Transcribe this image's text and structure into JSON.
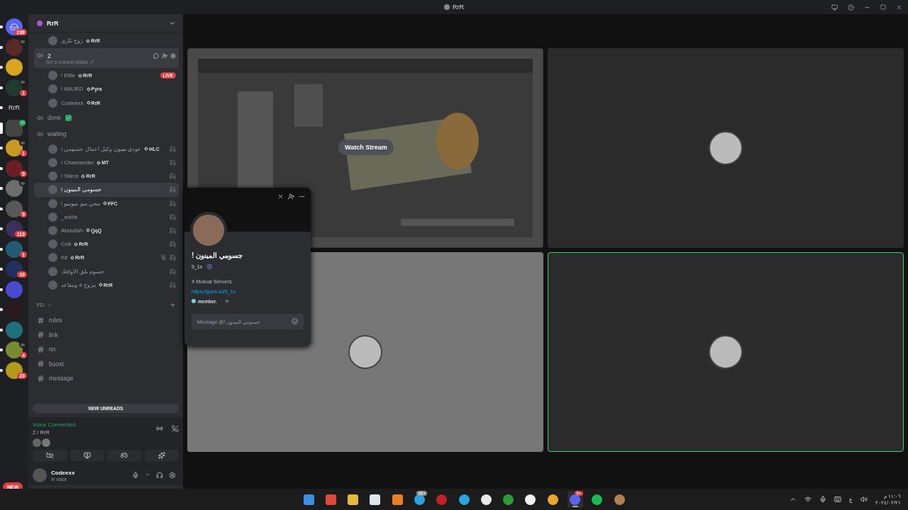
{
  "window": {
    "title": "RrR"
  },
  "servers": [
    {
      "kind": "home",
      "color": "#5865f2",
      "badge": "238",
      "voice": false,
      "selected": false
    },
    {
      "kind": "avatar",
      "color": "#5a2a2a",
      "voice": true,
      "selected": false
    },
    {
      "kind": "avatar",
      "color": "#d9a520",
      "voice": false,
      "selected": false
    },
    {
      "kind": "avatar",
      "color": "#1f3a30",
      "badge": "1",
      "voice": true,
      "selected": false
    },
    {
      "kind": "text",
      "label": "RrR",
      "voice": false,
      "selected": false
    },
    {
      "kind": "avatar",
      "color": "#444444",
      "voice": true,
      "selected": true
    },
    {
      "kind": "avatar",
      "color": "#c99a22",
      "badge": "1",
      "voice": true,
      "selected": false
    },
    {
      "kind": "avatar",
      "color": "#6b1f24",
      "badge": "5",
      "voice": false,
      "selected": false
    },
    {
      "kind": "avatar",
      "color": "#6e6e6e",
      "voice": true,
      "selected": false
    },
    {
      "kind": "avatar",
      "color": "#585858",
      "badge": "5",
      "voice": false,
      "selected": false
    },
    {
      "kind": "avatar",
      "color": "#3b2f5c",
      "badge": "113",
      "voice": false,
      "selected": false
    },
    {
      "kind": "avatar",
      "color": "#245a73",
      "badge": "1",
      "voice": false,
      "selected": false
    },
    {
      "kind": "avatar",
      "color": "#23305e",
      "badge": "10",
      "voice": false,
      "selected": false
    },
    {
      "kind": "avatar",
      "color": "#4a4ad0",
      "voice": false,
      "selected": false
    },
    {
      "kind": "avatar",
      "color": "#2a1a20",
      "voice": false,
      "selected": false
    },
    {
      "kind": "avatar",
      "color": "#1f6f7a",
      "voice": false,
      "selected": false
    },
    {
      "kind": "avatar",
      "color": "#7a8a30",
      "badge": "4",
      "voice": true,
      "selected": false
    },
    {
      "kind": "avatar",
      "color": "#b59a1a",
      "badge": "23",
      "voice": false,
      "selected": false
    }
  ],
  "new_indicator": "NEW",
  "guild": {
    "name": "RrR"
  },
  "channels": [
    {
      "kind": "user",
      "name": "زوج تكرى",
      "tag": "RrR",
      "live": false,
      "deafened": false,
      "muted": false,
      "hovered": false
    },
    {
      "kind": "voice",
      "name": "2",
      "status": "Set a channel status",
      "selected": true
    },
    {
      "kind": "user",
      "name": "! Elite",
      "tag": "RrR",
      "live": true,
      "live_label": "LIVE",
      "deafened": false,
      "muted": false,
      "hovered": false
    },
    {
      "kind": "user",
      "name": "! MAJED",
      "tag": "Pyra",
      "live": false,
      "deafened": false,
      "muted": false,
      "hovered": false
    },
    {
      "kind": "user",
      "name": "Codeexx",
      "tag": "RrR",
      "live": false,
      "deafened": false,
      "muted": false,
      "hovered": false
    },
    {
      "kind": "voice",
      "name": "done",
      "done": true,
      "selected": false
    },
    {
      "kind": "voice",
      "name": "waiting",
      "selected": false
    },
    {
      "kind": "user",
      "name": "! عودي مينون وكيل اعمال جسومي",
      "tag": "HLC",
      "live": false,
      "deafened": true,
      "muted": false,
      "hovered": false
    },
    {
      "kind": "user",
      "name": "! Chamander",
      "tag": "MT",
      "live": false,
      "deafened": true,
      "muted": false,
      "hovered": false
    },
    {
      "kind": "user",
      "name": "! Silent",
      "tag": "RrR",
      "live": false,
      "deafened": true,
      "muted": false,
      "hovered": false
    },
    {
      "kind": "user",
      "name": "! جسومي المينون",
      "live": false,
      "deafened": true,
      "muted": false,
      "hovered": true
    },
    {
      "kind": "user",
      "name": "! محي ميو ميوميو",
      "tag": "FFC",
      "live": false,
      "deafened": true,
      "muted": false,
      "hovered": false
    },
    {
      "kind": "user",
      "name": "_sol9s",
      "live": false,
      "deafened": true,
      "muted": false,
      "hovered": false
    },
    {
      "kind": "user",
      "name": "Abdullah",
      "tag": "QqQ",
      "live": false,
      "deafened": true,
      "muted": false,
      "hovered": false
    },
    {
      "kind": "user",
      "name": "Colt",
      "tag": "RrR",
      "live": false,
      "deafened": true,
      "muted": false,
      "hovered": false
    },
    {
      "kind": "user",
      "name": "Kil",
      "tag": "RrR",
      "live": false,
      "deafened": true,
      "muted": true,
      "hovered": false
    },
    {
      "kind": "user",
      "name": "جسوم بلق الاوافك",
      "live": false,
      "deafened": true,
      "muted": false,
      "hovered": false
    },
    {
      "kind": "user",
      "name": "مزوج 4 ومفاعد",
      "tag": "RrR",
      "live": false,
      "deafened": true,
      "muted": false,
      "hovered": false
    },
    {
      "kind": "category",
      "name": "FD."
    },
    {
      "kind": "text",
      "name": "rules",
      "selected": false
    },
    {
      "kind": "text",
      "name": "link",
      "selected": false
    },
    {
      "kind": "text",
      "name": "nn",
      "selected": false
    },
    {
      "kind": "text",
      "name": "boost",
      "selected": false
    },
    {
      "kind": "text",
      "name": "message",
      "selected": false
    }
  ],
  "new_unreads": "NEW UNREADS",
  "voice_panel": {
    "status": "Voice Connected",
    "channel": "2 / RrR"
  },
  "user_panel": {
    "name": "Codeexx",
    "status": "In voice"
  },
  "tiles": [
    {
      "kind": "stream",
      "button": "Watch Stream",
      "speaking": false
    },
    {
      "kind": "avatar",
      "color": "#2b2b2b",
      "speaking": false
    },
    {
      "kind": "avatar",
      "color": "#777777",
      "speaking": false
    },
    {
      "kind": "avatar",
      "color": "#2b2b2b",
      "speaking": true
    }
  ],
  "profile": {
    "name": "! جسومي المينون",
    "username": "9_1v",
    "mutual": "4 Mutual Servers",
    "link": "https://guns.lol/9_1v",
    "role": "member.",
    "placeholder": "Message @! جسومي المينون"
  },
  "taskbar": {
    "apps": [
      {
        "color": "#3b8fe0",
        "active": false
      },
      {
        "color": "#e04a3a",
        "active": false
      },
      {
        "color": "#e8b83a",
        "active": false
      },
      {
        "color": "#dfe6ee",
        "active": false
      },
      {
        "color": "#e8802a",
        "active": false
      },
      {
        "color": "#2aa3e0",
        "badge": "99+",
        "active": false
      },
      {
        "color": "#c0202a",
        "active": false
      },
      {
        "color": "#2aa3e0",
        "active": false
      },
      {
        "color": "#e8e8e8",
        "active": false
      },
      {
        "color": "#2e9a3a",
        "active": false
      },
      {
        "color": "#f0f0f0",
        "active": false
      },
      {
        "color": "#e8a830",
        "active": false
      },
      {
        "color": "#5865f2",
        "badge": "9+",
        "active": true
      },
      {
        "color": "#1db954",
        "active": false
      },
      {
        "color": "#b08050",
        "active": false
      }
    ],
    "language": "ع",
    "time": "١١:٠٦ م",
    "date": "٢٠٢٤/٠٢/٢١"
  }
}
